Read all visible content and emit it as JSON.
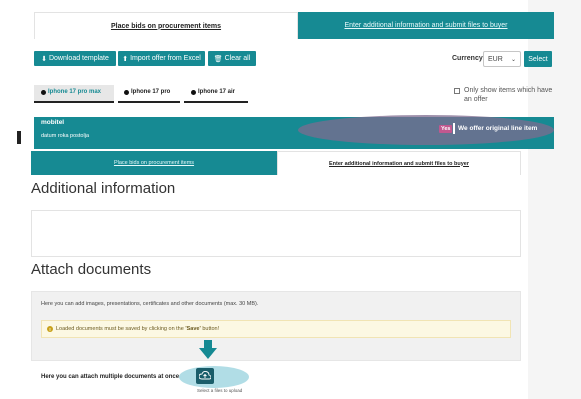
{
  "top_tabs": {
    "bids": "Place bids on procurement items",
    "additional": "Enter additional information and submit files to buyer"
  },
  "toolbar": {
    "download": "Download template",
    "import": "Import offer from Excel",
    "clear": "Clear all",
    "currency_label": "Currency",
    "currency_value": "EUR",
    "select": "Select"
  },
  "product_tabs": [
    {
      "label": "Iphone 17 pro max"
    },
    {
      "label": "Iphone 17 pro"
    },
    {
      "label": "Iphone 17 air"
    }
  ],
  "filter": {
    "label": "Only show items which have an offer"
  },
  "band": {
    "title": "mobitel",
    "subtitle": "datum roka postolja",
    "yes": "Yes",
    "offer": "We offer original line item"
  },
  "second_tabs": {
    "bids": "Place bids on procurement items",
    "additional": "Enter additional information and submit files to buyer"
  },
  "additional_info": {
    "title": "Additional information"
  },
  "attach": {
    "title": "Attach documents",
    "description": "Here you can add images, presentations, certificates and other documents (max. 30 MB).",
    "warning_prefix": "Loaded documents must be saved by clicking on the ",
    "warning_save": "'Save'",
    "warning_suffix": " button!",
    "multi": "Here you can attach multiple documents at once",
    "upload_hint": "Select a files to upload"
  },
  "colors": {
    "teal": "#168a93",
    "badge": "#c0588f",
    "highlight": "#7d6b8f"
  }
}
